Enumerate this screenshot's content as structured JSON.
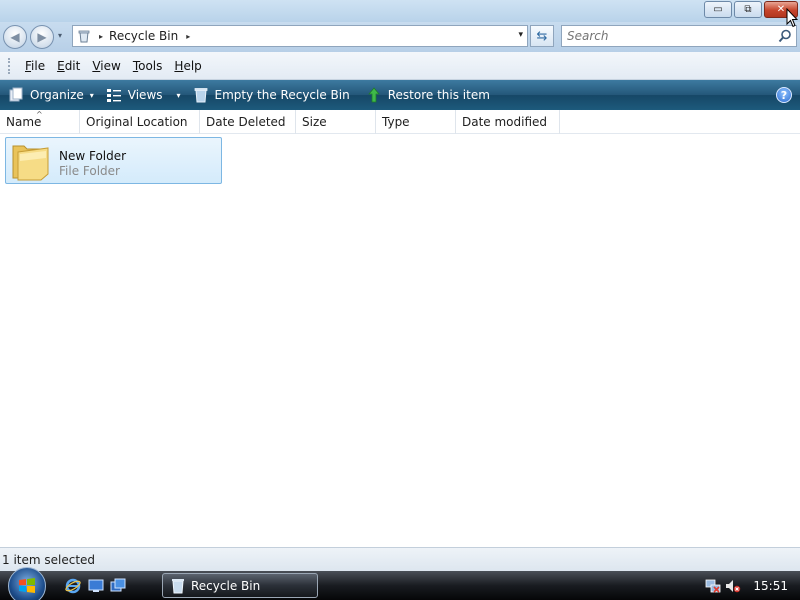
{
  "window": {
    "controls": {
      "minimize": "▭",
      "maximize": "⧉",
      "close": "✕"
    }
  },
  "address_bar": {
    "breadcrumb": "Recycle Bin",
    "separator": "▸",
    "dropdown": "▾",
    "refresh": "⇆"
  },
  "search": {
    "placeholder": "Search"
  },
  "menu": {
    "items": [
      {
        "label_u": "F",
        "label_rest": "ile"
      },
      {
        "label_u": "E",
        "label_rest": "dit"
      },
      {
        "label_u": "V",
        "label_rest": "iew"
      },
      {
        "label_u": "T",
        "label_rest": "ools"
      },
      {
        "label_u": "H",
        "label_rest": "elp"
      }
    ]
  },
  "command_bar": {
    "organize": "Organize",
    "views": "Views",
    "empty": "Empty the Recycle Bin",
    "restore": "Restore this item",
    "help": "?",
    "caret": "▾"
  },
  "columns": [
    "Name",
    "Original Location",
    "Date Deleted",
    "Size",
    "Type",
    "Date modified"
  ],
  "sort_indicator": "^",
  "files": [
    {
      "name": "New Folder",
      "type": "File Folder"
    }
  ],
  "status_bar": {
    "text": "1 item selected"
  },
  "taskbar": {
    "active_window": "Recycle Bin",
    "clock": "15:51"
  },
  "colors": {
    "command_bar": "#245779",
    "selection": "#d4ebfb",
    "close_button": "#c6452c"
  },
  "icons": {
    "window": "recycle-bin-icon",
    "item": "folder-icon",
    "empty": "recycle-bin-icon",
    "restore": "green-arrow-icon"
  }
}
